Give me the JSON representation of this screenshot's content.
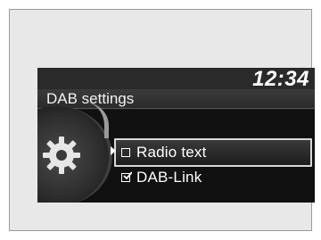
{
  "status_bar": {
    "clock": "12:34"
  },
  "header": {
    "title": "DAB settings"
  },
  "menu": {
    "items": [
      {
        "label": "Radio text",
        "checked": false,
        "selected": true
      },
      {
        "label": "DAB-Link",
        "checked": true,
        "selected": false
      }
    ]
  },
  "icons": {
    "category": "gear-icon"
  },
  "colors": {
    "screen_bg": "#1a1a1a",
    "text": "#ffffff",
    "highlight_border": "#d8d8d8"
  }
}
